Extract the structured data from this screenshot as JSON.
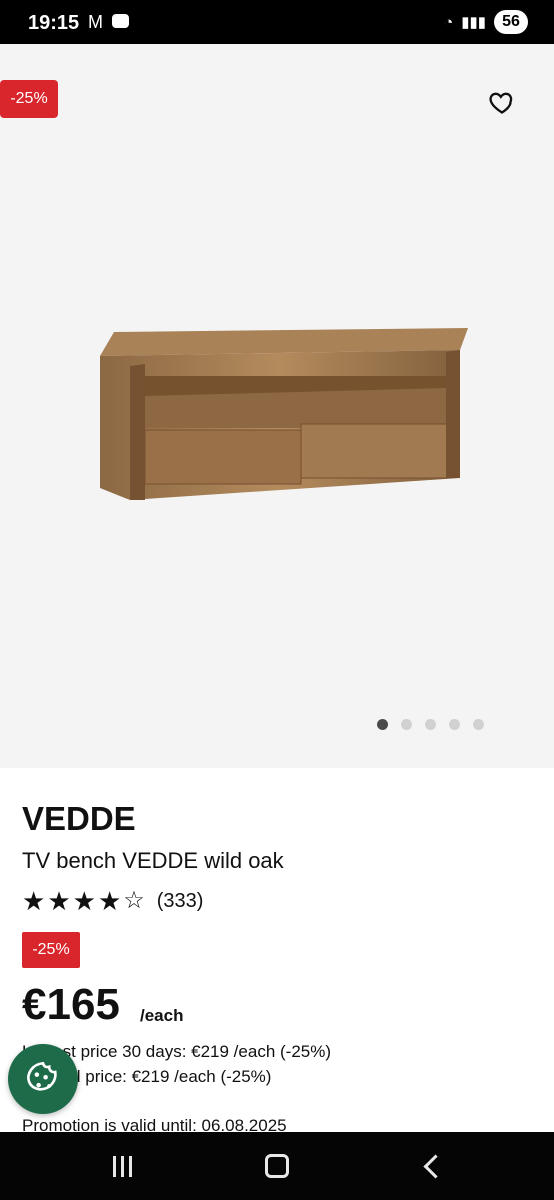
{
  "status_bar": {
    "time": "19:15",
    "battery": "56"
  },
  "product": {
    "brand": "VEDDE",
    "name": "TV bench VEDDE wild oak",
    "rating_count": "(333)",
    "discount_badge": "-25%",
    "hero_discount": "-25%",
    "price": "€165",
    "unit": "/each",
    "lowest_price_line": "Lowest price 30 days: €219 /each (-25%)",
    "original_price_line": "Original price: €219 /each (-25%)",
    "promotion_line": "Promotion is valid until: 06.08.2025",
    "rating_stars": 4
  },
  "icons": {
    "mail": "M",
    "message": "message-icon",
    "wifi": "wifi-icon",
    "signal": "signal-icon",
    "favorite": "heart-outline-icon",
    "cookie": "cookie-icon",
    "recent": "recent-apps-icon",
    "home": "home-icon",
    "back": "back-icon"
  },
  "colors": {
    "sale_red": "#d8262c",
    "cookie_green": "#1d6b49"
  }
}
